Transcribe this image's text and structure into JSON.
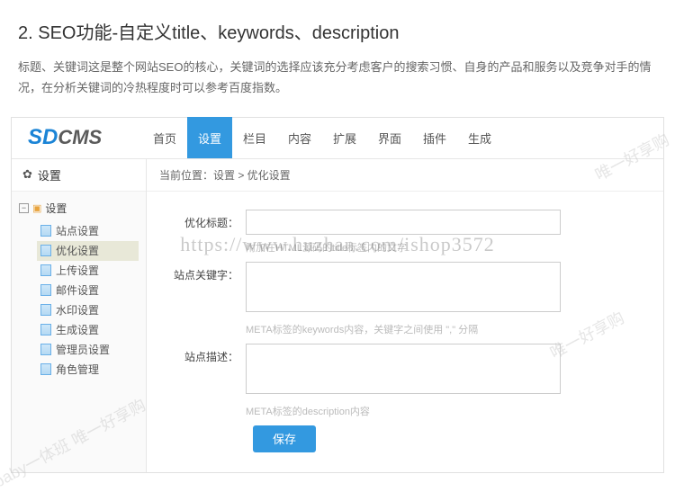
{
  "article": {
    "heading": "2. SEO功能-自定义title、keywords、description",
    "paragraph": "标题、关键词这是整个网站SEO的核心，关键词的选择应该充分考虑客户的搜索习惯、自身的产品和服务以及竞争对手的情况，在分析关键词的冷热程度时可以参考百度指数。"
  },
  "logo": {
    "sd": "SD",
    "cms": "CMS"
  },
  "nav": {
    "items": [
      {
        "label": "首页",
        "active": false
      },
      {
        "label": "设置",
        "active": true
      },
      {
        "label": "栏目",
        "active": false
      },
      {
        "label": "内容",
        "active": false
      },
      {
        "label": "扩展",
        "active": false
      },
      {
        "label": "界面",
        "active": false
      },
      {
        "label": "插件",
        "active": false
      },
      {
        "label": "生成",
        "active": false
      }
    ]
  },
  "sidebar": {
    "title": "设置",
    "root": "设置",
    "items": [
      {
        "label": "站点设置",
        "active": false
      },
      {
        "label": "优化设置",
        "active": true
      },
      {
        "label": "上传设置",
        "active": false
      },
      {
        "label": "邮件设置",
        "active": false
      },
      {
        "label": "水印设置",
        "active": false
      },
      {
        "label": "生成设置",
        "active": false
      },
      {
        "label": "管理员设置",
        "active": false
      },
      {
        "label": "角色管理",
        "active": false
      }
    ]
  },
  "breadcrumb": "当前位置：设置 > 优化设置",
  "form": {
    "title_label": "优化标题：",
    "title_value": "",
    "title_hint": "附加在HTML源码的title标签内的文字",
    "keywords_label": "站点关键字：",
    "keywords_value": "",
    "keywords_hint": "META标签的keywords内容，关键字之间使用 \",\" 分隔",
    "desc_label": "站点描述：",
    "desc_value": "",
    "desc_hint": "META标签的description内容",
    "save": "保存"
  },
  "watermark": {
    "url": "https://www.huzhan.com/ishop3572",
    "diag1": "baby一体班 唯一好享购",
    "diag2": "唯一好享购"
  }
}
